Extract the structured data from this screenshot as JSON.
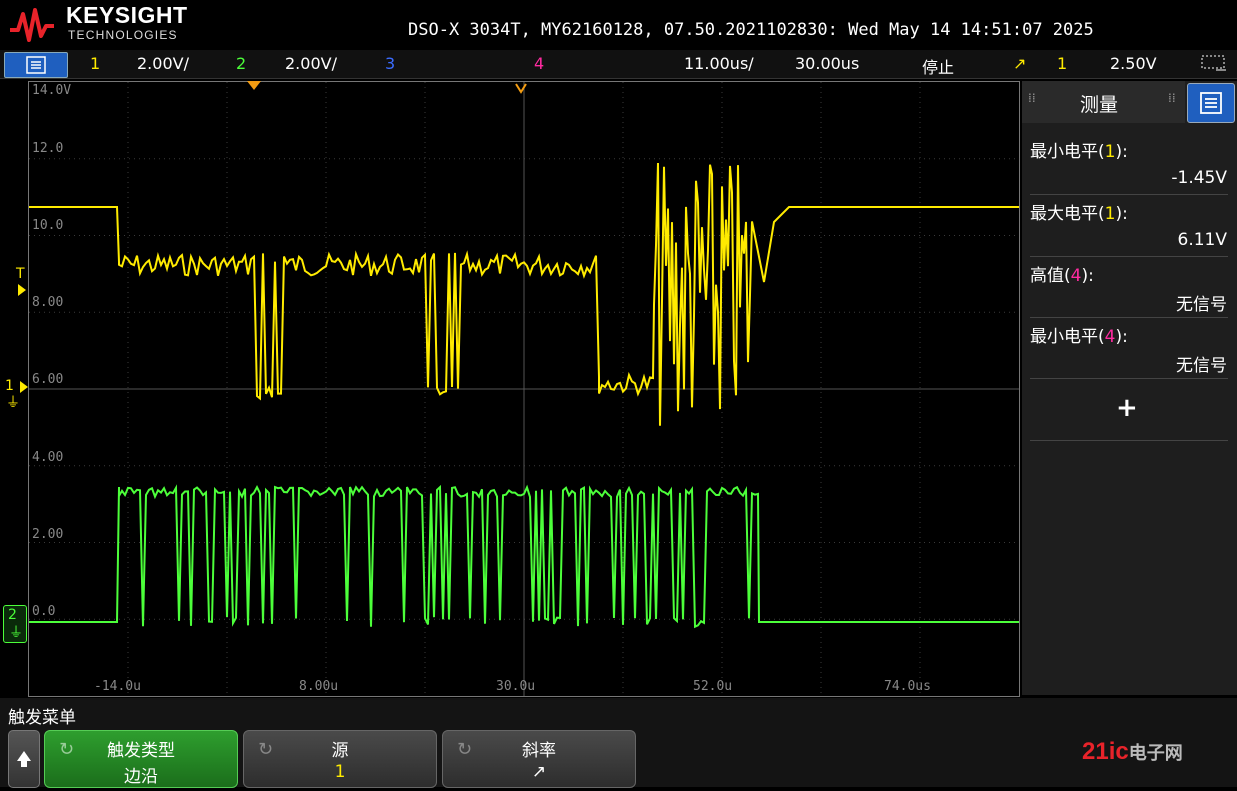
{
  "header": {
    "brand": "KEYSIGHT",
    "brand_sub": "TECHNOLOGIES",
    "device_info": "DSO-X 3034T, MY62160128, 07.50.2021102830: Wed May 14 14:51:07 2025"
  },
  "status_bar": {
    "ch1_num": "1",
    "ch1_scale": "2.00V/",
    "ch2_num": "2",
    "ch2_scale": "2.00V/",
    "ch3_num": "3",
    "ch4_num": "4",
    "time_scale": "11.00us/",
    "delay": "30.00us",
    "run_state": "停止",
    "trigger_slope_symbol": "↗",
    "trigger_source": "1",
    "trigger_level": "2.50V"
  },
  "screen": {
    "y_labels": [
      "14.0V",
      "12.0",
      "10.0",
      "8.00",
      "6.00",
      "4.00",
      "2.00",
      "0.0"
    ],
    "x_labels": [
      "-14.0u",
      "8.00u",
      "30.0u",
      "52.0u",
      "74.0us"
    ],
    "ch1_marker": "1",
    "ch2_marker": "2",
    "trigger_marker": "T"
  },
  "side_panel": {
    "title": "测量",
    "measurements": [
      {
        "label": "最小电平",
        "ch": "1",
        "value": "-1.45V"
      },
      {
        "label": "最大电平",
        "ch": "1",
        "value": "6.11V"
      },
      {
        "label": "高值",
        "ch": "4",
        "value": "无信号"
      },
      {
        "label": "最小电平",
        "ch": "4",
        "value": "无信号"
      }
    ],
    "add_symbol": "+",
    "open_paren": "(",
    "close_paren": "):"
  },
  "bottom": {
    "menu_title": "触发菜单",
    "softkeys": [
      {
        "label": "触发类型",
        "value": "边沿"
      },
      {
        "label": "源",
        "value": "1"
      },
      {
        "label": "斜率",
        "value": "↗"
      }
    ]
  },
  "footer_logo": {
    "part1": "21ic",
    "part2": "电子网"
  },
  "colors": {
    "ch1": "#ffeb00",
    "ch2": "#4cff3a",
    "ch3": "#3b6cff",
    "ch4": "#ff2ba0",
    "menu_blue": "#1f5fbf"
  }
}
